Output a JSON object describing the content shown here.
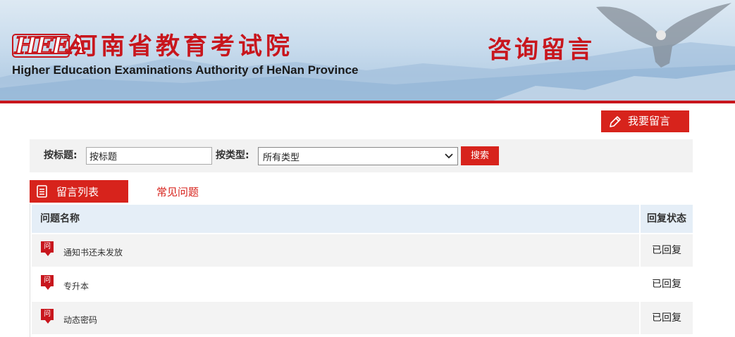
{
  "header": {
    "logo_text": "HEEA",
    "org_name_cn": "河南省教育考试院",
    "org_name_en": "Higher Education Examinations Authority of HeNan Province",
    "page_heading": "咨询留言"
  },
  "actions": {
    "write_message_label": "我要留言"
  },
  "search": {
    "title_label": "按标题:",
    "title_value": "按标题",
    "type_label": "按类型:",
    "type_selected": "所有类型",
    "search_button": "搜索"
  },
  "tabs": [
    {
      "label": "留言列表",
      "active": true
    },
    {
      "label": "常见问题",
      "active": false
    }
  ],
  "table": {
    "headers": {
      "name": "问题名称",
      "status": "回复状态"
    },
    "icon_glyph": "问",
    "rows": [
      {
        "title": "通知书还未发放",
        "status": "已回复"
      },
      {
        "title": "专升本",
        "status": "已回复"
      },
      {
        "title": "动态密码",
        "status": "已回复"
      }
    ]
  },
  "colors": {
    "brand_red": "#d7231c",
    "header_blue": "#c9dced",
    "table_header_bg": "#e5eef7"
  }
}
